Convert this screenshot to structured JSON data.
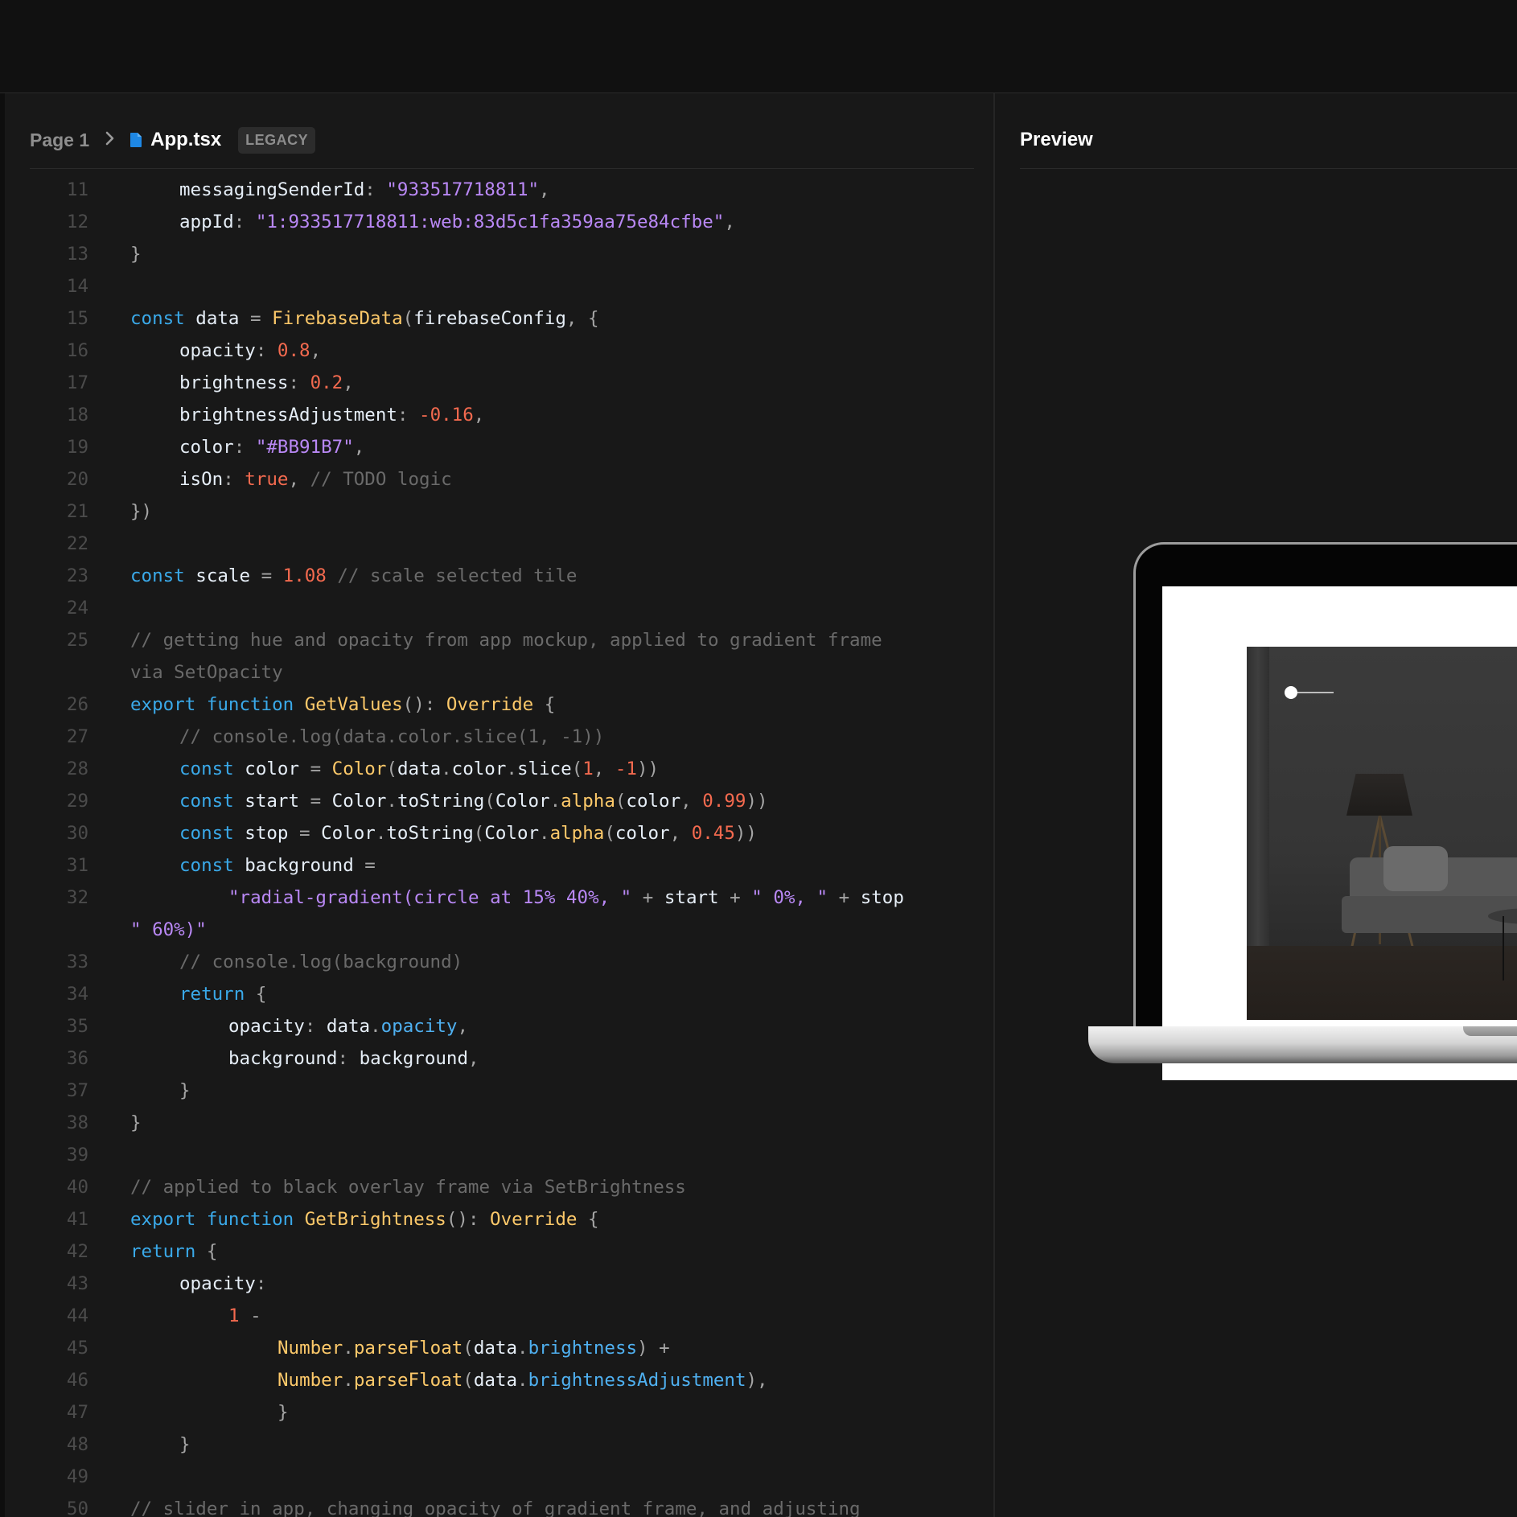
{
  "breadcrumb": {
    "page": "Page 1",
    "file": "App.tsx",
    "badge": "LEGACY"
  },
  "preview": {
    "title": "Preview"
  },
  "colors": {
    "keyword": "#3aa9e9",
    "function": "#fdc96a",
    "string": "#b988f5",
    "number": "#f46a4f",
    "comment": "#6a6a6a",
    "property": "#4fb0f0",
    "identifier": "#ededed",
    "file_icon": "#1e88e5"
  },
  "code_lines": [
    {
      "n": "11",
      "tokens": [
        [
          "id",
          "messagingSenderId"
        ],
        [
          "p",
          ": "
        ],
        [
          "str",
          "\"933517718811\""
        ],
        [
          "p",
          ","
        ]
      ]
    },
    {
      "n": "12",
      "tokens": [
        [
          "id",
          "appId"
        ],
        [
          "p",
          ": "
        ],
        [
          "str",
          "\"1:933517718811:web:83d5c1fa359aa75e84cfbe\""
        ],
        [
          "p",
          ","
        ]
      ]
    },
    {
      "n": "13",
      "tokens": [
        [
          "p",
          "}"
        ]
      ]
    },
    {
      "n": "14",
      "tokens": []
    },
    {
      "n": "15",
      "tokens": [
        [
          "kw",
          "const"
        ],
        [
          "id",
          " data "
        ],
        [
          "p",
          "= "
        ],
        [
          "fn",
          "FirebaseData"
        ],
        [
          "p",
          "("
        ],
        [
          "id",
          "firebaseConfig"
        ],
        [
          "p",
          ", {"
        ]
      ]
    },
    {
      "n": "16",
      "tokens": [
        [
          "id",
          "opacity"
        ],
        [
          "p",
          ": "
        ],
        [
          "num",
          "0.8"
        ],
        [
          "p",
          ","
        ]
      ]
    },
    {
      "n": "17",
      "tokens": [
        [
          "id",
          "brightness"
        ],
        [
          "p",
          ": "
        ],
        [
          "num",
          "0.2"
        ],
        [
          "p",
          ","
        ]
      ]
    },
    {
      "n": "18",
      "tokens": [
        [
          "id",
          "brightnessAdjustment"
        ],
        [
          "p",
          ": "
        ],
        [
          "num",
          "-0.16"
        ],
        [
          "p",
          ","
        ]
      ]
    },
    {
      "n": "19",
      "tokens": [
        [
          "id",
          "color"
        ],
        [
          "p",
          ": "
        ],
        [
          "str",
          "\"#BB91B7\""
        ],
        [
          "p",
          ","
        ]
      ]
    },
    {
      "n": "20",
      "tokens": [
        [
          "id",
          "isOn"
        ],
        [
          "p",
          ": "
        ],
        [
          "num",
          "true"
        ],
        [
          "p",
          ", "
        ],
        [
          "com",
          "// TODO logic"
        ]
      ]
    },
    {
      "n": "21",
      "tokens": [
        [
          "p",
          "})"
        ]
      ]
    },
    {
      "n": "22",
      "tokens": []
    },
    {
      "n": "23",
      "tokens": [
        [
          "kw",
          "const"
        ],
        [
          "id",
          " scale "
        ],
        [
          "p",
          "= "
        ],
        [
          "num",
          "1.08"
        ],
        [
          "com",
          " // scale selected tile"
        ]
      ]
    },
    {
      "n": "24",
      "tokens": []
    },
    {
      "n": "25",
      "tokens": [
        [
          "com",
          "// getting hue and opacity from app mockup, applied to gradient frame"
        ]
      ]
    },
    {
      "n": "",
      "tokens": [
        [
          "com",
          "via SetOpacity"
        ]
      ]
    },
    {
      "n": "26",
      "tokens": [
        [
          "kw",
          "export function "
        ],
        [
          "fn",
          "GetValues"
        ],
        [
          "p",
          "(): "
        ],
        [
          "fn",
          "Override"
        ],
        [
          "p",
          " {"
        ]
      ]
    },
    {
      "n": "27",
      "tokens": [
        [
          "com",
          "// console.log(data.color.slice(1, -1))"
        ]
      ]
    },
    {
      "n": "28",
      "tokens": [
        [
          "kw",
          "const"
        ],
        [
          "id",
          " color "
        ],
        [
          "p",
          "= "
        ],
        [
          "fn",
          "Color"
        ],
        [
          "p",
          "("
        ],
        [
          "id",
          "data"
        ],
        [
          "p",
          "."
        ],
        [
          "id",
          "color"
        ],
        [
          "p",
          "."
        ],
        [
          "id",
          "slice"
        ],
        [
          "p",
          "("
        ],
        [
          "num",
          "1"
        ],
        [
          "p",
          ", "
        ],
        [
          "num",
          "-1"
        ],
        [
          "p",
          "))"
        ]
      ]
    },
    {
      "n": "29",
      "tokens": [
        [
          "kw",
          "const"
        ],
        [
          "id",
          " start "
        ],
        [
          "p",
          "= "
        ],
        [
          "id",
          "Color"
        ],
        [
          "p",
          "."
        ],
        [
          "id",
          "toString"
        ],
        [
          "p",
          "("
        ],
        [
          "id",
          "Color"
        ],
        [
          "p",
          "."
        ],
        [
          "fn",
          "alpha"
        ],
        [
          "p",
          "("
        ],
        [
          "id",
          "color"
        ],
        [
          "p",
          ", "
        ],
        [
          "num",
          "0.99"
        ],
        [
          "p",
          "))"
        ]
      ]
    },
    {
      "n": "30",
      "tokens": [
        [
          "kw",
          "const"
        ],
        [
          "id",
          " stop "
        ],
        [
          "p",
          "= "
        ],
        [
          "id",
          "Color"
        ],
        [
          "p",
          "."
        ],
        [
          "id",
          "toString"
        ],
        [
          "p",
          "("
        ],
        [
          "id",
          "Color"
        ],
        [
          "p",
          "."
        ],
        [
          "fn",
          "alpha"
        ],
        [
          "p",
          "("
        ],
        [
          "id",
          "color"
        ],
        [
          "p",
          ", "
        ],
        [
          "num",
          "0.45"
        ],
        [
          "p",
          "))"
        ]
      ]
    },
    {
      "n": "31",
      "tokens": [
        [
          "kw",
          "const"
        ],
        [
          "id",
          " background "
        ],
        [
          "p",
          "="
        ]
      ]
    },
    {
      "n": "32",
      "tokens": [
        [
          "str",
          "\"radial-gradient(circle at 15% 40%, \""
        ],
        [
          "p",
          " + "
        ],
        [
          "id",
          "start"
        ],
        [
          "p",
          " + "
        ],
        [
          "str",
          "\" 0%, \""
        ],
        [
          "p",
          " + "
        ],
        [
          "id",
          "stop"
        ]
      ]
    },
    {
      "n": "",
      "tokens": [
        [
          "str",
          "\" 60%)\""
        ]
      ]
    },
    {
      "n": "33",
      "tokens": [
        [
          "com",
          "// console.log(background)"
        ]
      ]
    },
    {
      "n": "34",
      "tokens": [
        [
          "kw",
          "return"
        ],
        [
          "p",
          " {"
        ]
      ]
    },
    {
      "n": "35",
      "tokens": [
        [
          "id",
          "opacity"
        ],
        [
          "p",
          ": "
        ],
        [
          "id",
          "data"
        ],
        [
          "p",
          "."
        ],
        [
          "prop",
          "opacity"
        ],
        [
          "p",
          ","
        ]
      ]
    },
    {
      "n": "36",
      "tokens": [
        [
          "id",
          "background"
        ],
        [
          "p",
          ": "
        ],
        [
          "id",
          "background"
        ],
        [
          "p",
          ","
        ]
      ]
    },
    {
      "n": "37",
      "tokens": [
        [
          "p",
          "}"
        ]
      ]
    },
    {
      "n": "38",
      "tokens": [
        [
          "p",
          "}"
        ]
      ]
    },
    {
      "n": "39",
      "tokens": []
    },
    {
      "n": "40",
      "tokens": [
        [
          "com",
          "// applied to black overlay frame via SetBrightness"
        ]
      ]
    },
    {
      "n": "41",
      "tokens": [
        [
          "kw",
          "export function "
        ],
        [
          "fn",
          "GetBrightness"
        ],
        [
          "p",
          "(): "
        ],
        [
          "fn",
          "Override"
        ],
        [
          "p",
          " {"
        ]
      ]
    },
    {
      "n": "42",
      "tokens": [
        [
          "kw",
          "return"
        ],
        [
          "p",
          " {"
        ]
      ]
    },
    {
      "n": "43",
      "tokens": [
        [
          "id",
          "opacity"
        ],
        [
          "p",
          ":"
        ]
      ]
    },
    {
      "n": "44",
      "tokens": [
        [
          "num",
          "1"
        ],
        [
          "p",
          " -"
        ]
      ]
    },
    {
      "n": "45",
      "tokens": [
        [
          "fn",
          "Number"
        ],
        [
          "p",
          "."
        ],
        [
          "fn",
          "parseFloat"
        ],
        [
          "p",
          "("
        ],
        [
          "id",
          "data"
        ],
        [
          "p",
          "."
        ],
        [
          "prop",
          "brightness"
        ],
        [
          "p",
          ") +"
        ]
      ]
    },
    {
      "n": "46",
      "tokens": [
        [
          "fn",
          "Number"
        ],
        [
          "p",
          "."
        ],
        [
          "fn",
          "parseFloat"
        ],
        [
          "p",
          "("
        ],
        [
          "id",
          "data"
        ],
        [
          "p",
          "."
        ],
        [
          "prop",
          "brightnessAdjustment"
        ],
        [
          "p",
          "),"
        ]
      ]
    },
    {
      "n": "47",
      "tokens": [
        [
          "p",
          "}"
        ]
      ]
    },
    {
      "n": "48",
      "tokens": [
        [
          "p",
          "}"
        ]
      ]
    },
    {
      "n": "49",
      "tokens": []
    },
    {
      "n": "50",
      "tokens": [
        [
          "com",
          "// slider in app, changing opacity of gradient frame, and adjusting"
        ]
      ]
    }
  ]
}
